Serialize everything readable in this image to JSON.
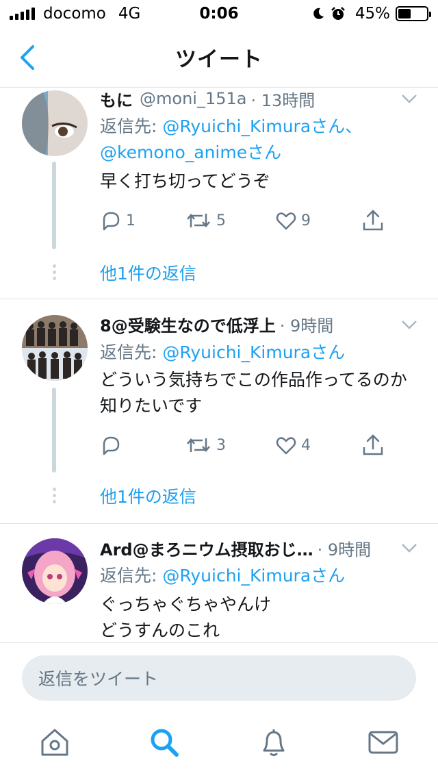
{
  "status_bar": {
    "carrier": "docomo",
    "network": "4G",
    "time": "0:06",
    "battery_percent": "45%",
    "battery_level": 0.45,
    "icons": [
      "signal-icon",
      "moon-icon",
      "alarm-icon",
      "battery-icon"
    ]
  },
  "nav": {
    "title": "ツイート",
    "back_icon": "chevron-left-icon"
  },
  "tweets": [
    {
      "name": "もに",
      "handle": "@moni_151a",
      "time": "· 13時間",
      "reply_prefix": "返信先: ",
      "mention_1": "@Ryuichi_Kimura",
      "suffix_1": "さん、",
      "mention_2": "@kemono_anime",
      "suffix_2": "さん",
      "text": "早く打ち切ってどうぞ",
      "reply_count": "1",
      "retweet_count": "5",
      "like_count": "9",
      "show_replies": "他1件の返信"
    },
    {
      "name": "8@受験生なので低浮上",
      "time": "· 9時間",
      "reply_prefix": "返信先: ",
      "mention_1": "@Ryuichi_Kimura",
      "suffix_1": "さん",
      "text": "どういう気持ちでこの作品作ってるのか知りたいです",
      "reply_count": "",
      "retweet_count": "3",
      "like_count": "4",
      "show_replies": "他1件の返信"
    },
    {
      "name": "Ard@まろニウム摂取おじ…",
      "time": "· 9時間",
      "reply_prefix": "返信先: ",
      "mention_1": "@Ryuichi_Kimura",
      "suffix_1": "さん",
      "text_line_1": "ぐっちゃぐちゃやんけ",
      "text_line_2": "どうすんのこれ"
    }
  ],
  "reply_bar": {
    "placeholder": "返信をツイート"
  },
  "tab_bar": {
    "icons": [
      "home-icon",
      "search-icon",
      "notifications-icon",
      "messages-icon"
    ],
    "active": "search-icon",
    "accent_color": "#1da1f2"
  },
  "colors": {
    "accent": "#1da1f2",
    "secondary_text": "#657786",
    "thread_line": "#ccd6dd"
  }
}
